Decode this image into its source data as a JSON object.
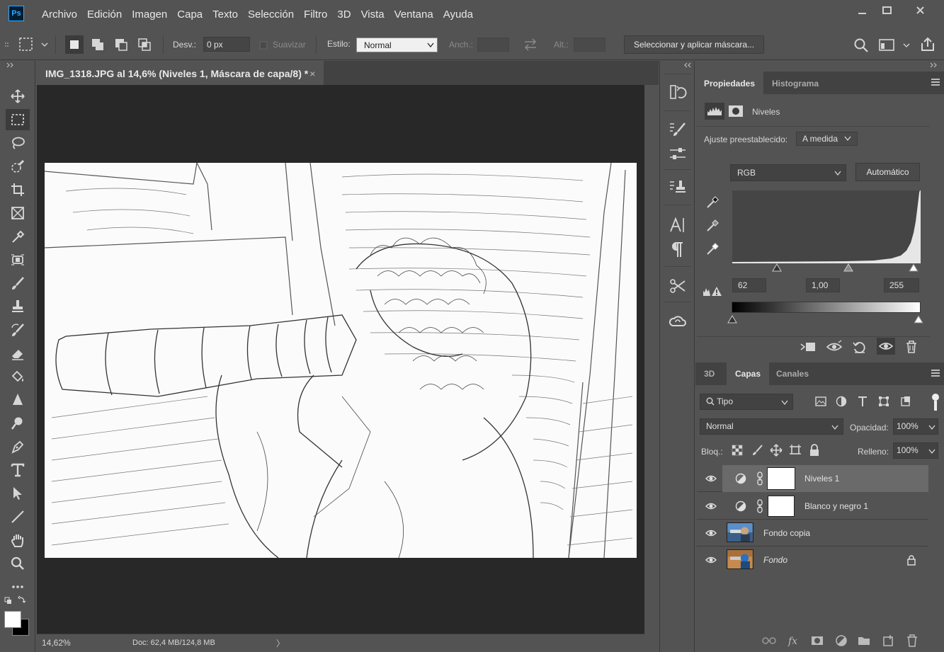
{
  "app": {
    "logo": "Ps"
  },
  "menu": [
    "Archivo",
    "Edición",
    "Imagen",
    "Capa",
    "Texto",
    "Selección",
    "Filtro",
    "3D",
    "Vista",
    "Ventana",
    "Ayuda"
  ],
  "options": {
    "desv_label": "Desv.:",
    "desv_value": "0 px",
    "suavizar_label": "Suavizar",
    "estilo_label": "Estilo:",
    "estilo_value": "Normal",
    "anch_label": "Anch.:",
    "alt_label": "Alt.:",
    "select_mask_button": "Seleccionar y aplicar máscara..."
  },
  "document": {
    "tab_title": "IMG_1318.JPG al 14,6% (Niveles 1, Máscara de capa/8) *",
    "close_glyph": "×",
    "zoom": "14,62%",
    "doc_info": "Doc: 62,4 MB/124,8 MB",
    "status_arrow": "〉"
  },
  "properties": {
    "tabs": [
      "Propiedades",
      "Histograma"
    ],
    "adjustment_name": "Niveles",
    "preset_label": "Ajuste preestablecido:",
    "preset_value": "A medida",
    "channel": "RGB",
    "auto_button": "Automático",
    "input_black": "62",
    "input_gamma": "1,00",
    "input_white": "255"
  },
  "layers_panel": {
    "tabs": [
      "3D",
      "Capas",
      "Canales"
    ],
    "filter_kind": "Tipo",
    "blend_mode": "Normal",
    "opacity_label": "Opacidad:",
    "opacity_value": "100%",
    "lock_label": "Bloq.:",
    "fill_label": "Relleno:",
    "fill_value": "100%",
    "layers": [
      {
        "name": "Niveles 1",
        "type": "adjustment",
        "selected": true
      },
      {
        "name": "Blanco y negro 1",
        "type": "adjustment",
        "selected": false
      },
      {
        "name": "Fondo copia",
        "type": "pixel",
        "selected": false
      },
      {
        "name": "Fondo",
        "type": "background",
        "locked": true,
        "selected": false
      }
    ]
  },
  "colors": {
    "accent": "#31a8ff",
    "panel": "#535353",
    "canvas_bg": "#282828"
  }
}
